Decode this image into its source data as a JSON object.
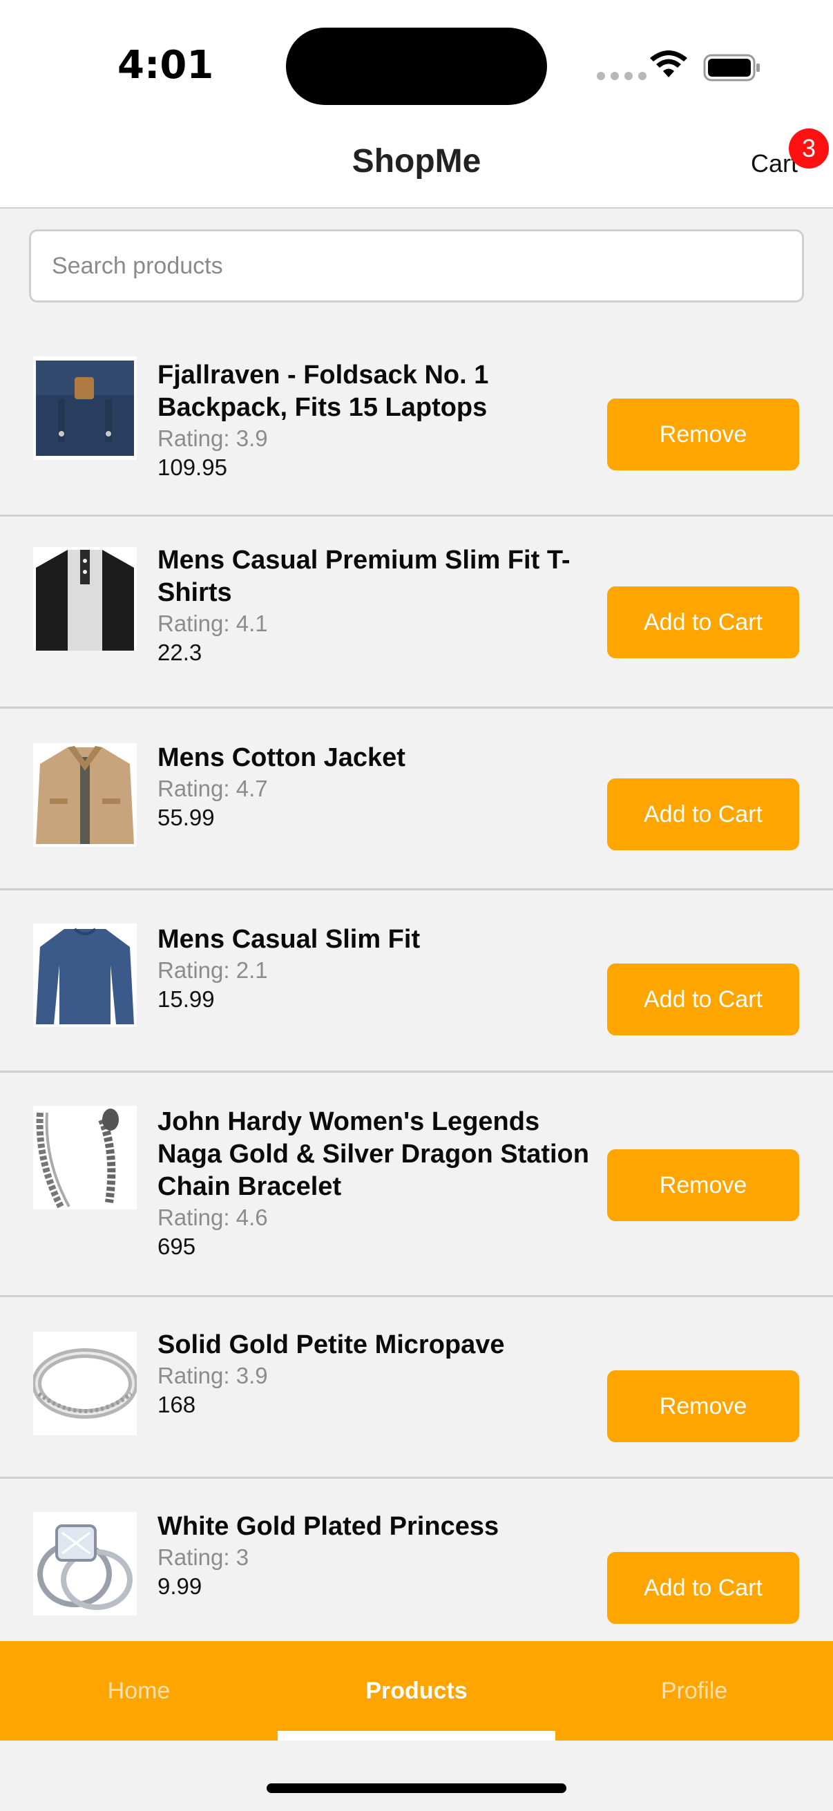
{
  "status_bar": {
    "time": "4:01"
  },
  "header": {
    "title": "ShopMe",
    "cart_label": "Cart",
    "cart_count": "3"
  },
  "search": {
    "placeholder": "Search products"
  },
  "products": [
    {
      "title": "Fjallraven - Foldsack No. 1 Backpack, Fits 15 Laptops",
      "rating": "Rating: 3.9",
      "price": "109.95",
      "action": "Remove"
    },
    {
      "title": "Mens Casual Premium Slim Fit T-Shirts",
      "rating": "Rating: 4.1",
      "price": "22.3",
      "action": "Add to Cart"
    },
    {
      "title": "Mens Cotton Jacket",
      "rating": "Rating: 4.7",
      "price": "55.99",
      "action": "Add to Cart"
    },
    {
      "title": "Mens Casual Slim Fit",
      "rating": "Rating: 2.1",
      "price": "15.99",
      "action": "Add to Cart"
    },
    {
      "title": "John Hardy Women's Legends Naga Gold & Silver Dragon Station Chain Bracelet",
      "rating": "Rating: 4.6",
      "price": "695",
      "action": "Remove"
    },
    {
      "title": "Solid Gold Petite Micropave",
      "rating": "Rating: 3.9",
      "price": "168",
      "action": "Remove"
    },
    {
      "title": "White Gold Plated Princess",
      "rating": "Rating: 3",
      "price": "9.99",
      "action": "Add to Cart"
    }
  ],
  "tabs": [
    {
      "label": "Home",
      "active": false
    },
    {
      "label": "Products",
      "active": true
    },
    {
      "label": "Profile",
      "active": false
    }
  ],
  "colors": {
    "accent": "#ffa500",
    "badge": "#ff1111",
    "background": "#f2f2f2"
  }
}
